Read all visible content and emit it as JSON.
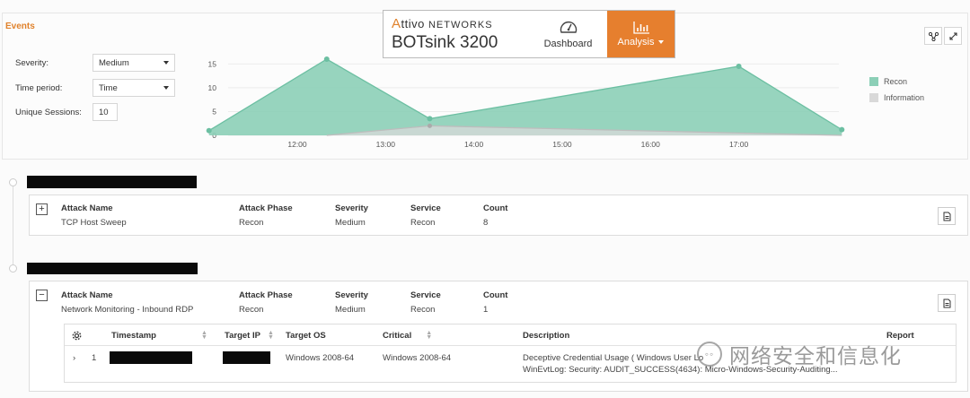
{
  "events": {
    "title": "Events",
    "form": {
      "severity_label": "Severity:",
      "severity_value": "Medium",
      "time_period_label": "Time period:",
      "time_period_value": "Time",
      "unique_sessions_label": "Unique Sessions:",
      "unique_sessions_value": "10"
    }
  },
  "chart_data": {
    "type": "area",
    "x": [
      "11:00",
      "12:20",
      "13:30",
      "17:00",
      "18:10"
    ],
    "xticks": [
      "12:00",
      "13:00",
      "14:00",
      "15:00",
      "16:00",
      "17:00"
    ],
    "yticks": [
      "15",
      "10",
      "5",
      "0"
    ],
    "ylim": [
      0,
      16
    ],
    "series": [
      {
        "name": "Recon",
        "color": "#8ccfb7",
        "line": "#6cbfa2",
        "values": [
          1,
          16,
          3.5,
          14.5,
          1.2
        ]
      },
      {
        "name": "Information",
        "color": "#d9d9d9",
        "line": "#bdbdbd",
        "values": [
          null,
          0,
          2,
          0.5,
          0
        ]
      }
    ],
    "legend": "right"
  },
  "brand": {
    "logo_a": "A",
    "logo_rest": "ttivo",
    "logo_networks": "NETWORKS",
    "product": "BOTsink 3200",
    "dashboard_label": "Dashboard",
    "analysis_label": "Analysis",
    "accent": "#e67f2e"
  },
  "attacks": [
    {
      "expand_symbol": "+",
      "headers": {
        "name": "Attack Name",
        "phase": "Attack Phase",
        "severity": "Severity",
        "service": "Service",
        "count": "Count"
      },
      "name": "TCP Host Sweep",
      "phase": "Recon",
      "severity": "Medium",
      "service": "Recon",
      "count": "8"
    },
    {
      "expand_symbol": "−",
      "headers": {
        "name": "Attack Name",
        "phase": "Attack Phase",
        "severity": "Severity",
        "service": "Service",
        "count": "Count"
      },
      "name": "Network Monitoring - Inbound RDP",
      "phase": "Recon",
      "severity": "Medium",
      "service": "Recon",
      "count": "1",
      "table": {
        "headers": {
          "timestamp": "Timestamp",
          "target_ip": "Target IP",
          "target_os": "Target OS",
          "critical": "Critical",
          "description": "Description",
          "report": "Report"
        },
        "rows": [
          {
            "index": "1",
            "target_os": "Windows 2008-64",
            "critical": "Windows 2008-64",
            "description_line1": "Deceptive Credential Usage ( Windows User Lo",
            "description_line2": "WinEvtLog: Security: AUDIT_SUCCESS(4634): Micro",
            "description_line2_end": "-Windows-Security-Auditing..."
          }
        ]
      }
    }
  ],
  "watermark": {
    "text": "网络安全和信息化"
  }
}
